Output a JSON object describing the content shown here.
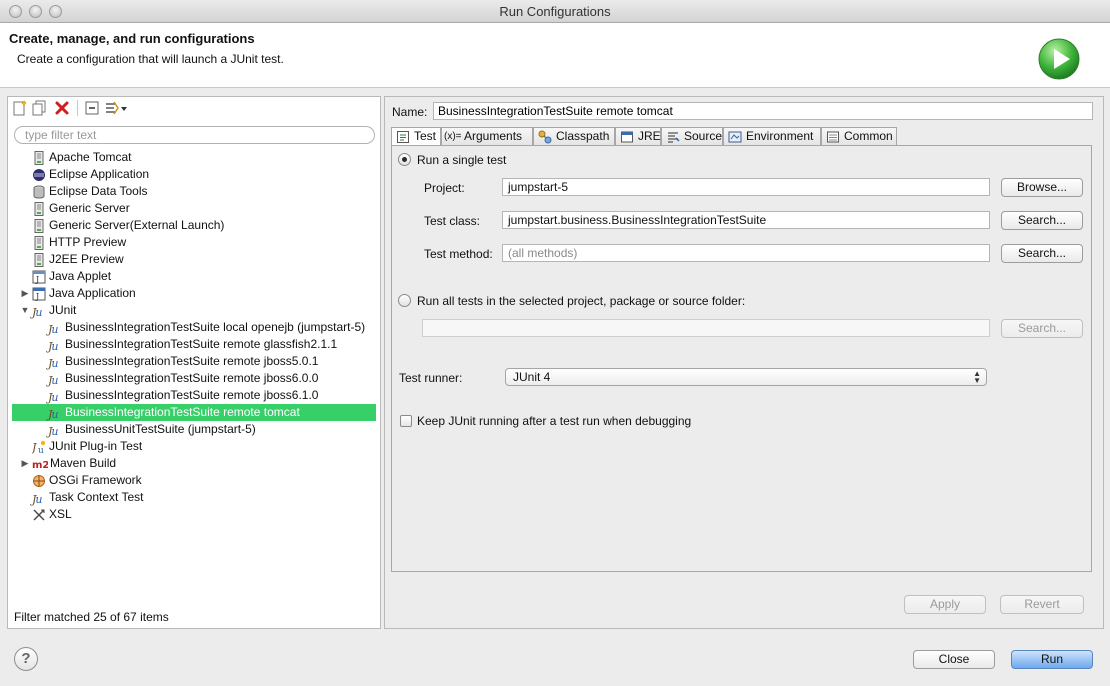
{
  "window": {
    "title": "Run Configurations"
  },
  "banner": {
    "heading": "Create, manage, and run configurations",
    "message": "Create a configuration that will launch a JUnit test."
  },
  "left": {
    "filter_placeholder": "type filter text",
    "tree": [
      {
        "label": "Apache Tomcat",
        "icon": "server-icon",
        "level": 0
      },
      {
        "label": "Eclipse Application",
        "icon": "eclipse-icon",
        "level": 0
      },
      {
        "label": "Eclipse Data Tools",
        "icon": "database-icon",
        "level": 0
      },
      {
        "label": "Generic Server",
        "icon": "server-icon",
        "level": 0
      },
      {
        "label": "Generic Server(External Launch)",
        "icon": "server-icon",
        "level": 0
      },
      {
        "label": "HTTP Preview",
        "icon": "server-icon",
        "level": 0
      },
      {
        "label": "J2EE Preview",
        "icon": "server-icon",
        "level": 0
      },
      {
        "label": "Java Applet",
        "icon": "applet-icon",
        "level": 0
      },
      {
        "label": "Java Application",
        "icon": "java-app-icon",
        "level": 0,
        "arrow": "collapsed"
      },
      {
        "label": "JUnit",
        "icon": "junit-icon",
        "level": 0,
        "arrow": "expanded"
      },
      {
        "label": "BusinessIntegrationTestSuite local openejb (jumpstart-5)",
        "icon": "junit-icon",
        "level": 1
      },
      {
        "label": "BusinessIntegrationTestSuite remote glassfish2.1.1",
        "icon": "junit-icon",
        "level": 1
      },
      {
        "label": "BusinessIntegrationTestSuite remote jboss5.0.1",
        "icon": "junit-icon",
        "level": 1
      },
      {
        "label": "BusinessIntegrationTestSuite remote jboss6.0.0",
        "icon": "junit-icon",
        "level": 1
      },
      {
        "label": "BusinessIntegrationTestSuite remote jboss6.1.0",
        "icon": "junit-icon",
        "level": 1
      },
      {
        "label": "BusinessIntegrationTestSuite remote tomcat",
        "icon": "junit-icon",
        "level": 1,
        "selected": true
      },
      {
        "label": "BusinessUnitTestSuite (jumpstart-5)",
        "icon": "junit-icon",
        "level": 1
      },
      {
        "label": "JUnit Plug-in Test",
        "icon": "junit-plugin-icon",
        "level": 0
      },
      {
        "label": "Maven Build",
        "icon": "maven-icon",
        "level": 0,
        "arrow": "collapsed"
      },
      {
        "label": "OSGi Framework",
        "icon": "osgi-icon",
        "level": 0
      },
      {
        "label": "Task Context Test",
        "icon": "junit-icon",
        "level": 0
      },
      {
        "label": "XSL",
        "icon": "xsl-icon",
        "level": 0
      }
    ],
    "status": "Filter matched 25 of 67 items"
  },
  "right": {
    "name_label": "Name:",
    "name_value": "BusinessIntegrationTestSuite remote tomcat",
    "tabs": [
      {
        "label": "Test",
        "icon": "test-tab-icon",
        "active": true
      },
      {
        "label": "Arguments",
        "icon": "arguments-icon",
        "prefix": "(x)="
      },
      {
        "label": "Classpath",
        "icon": "classpath-icon"
      },
      {
        "label": "JRE",
        "icon": "jre-icon"
      },
      {
        "label": "Source",
        "icon": "source-icon"
      },
      {
        "label": "Environment",
        "icon": "environment-icon"
      },
      {
        "label": "Common",
        "icon": "common-icon"
      }
    ],
    "test": {
      "single_label": "Run a single test",
      "project_label": "Project:",
      "project_value": "jumpstart-5",
      "browse_label": "Browse...",
      "class_label": "Test class:",
      "class_value": "jumpstart.business.BusinessIntegrationTestSuite",
      "class_search_label": "Search...",
      "method_label": "Test method:",
      "method_placeholder": "(all methods)",
      "method_search_label": "Search...",
      "all_label": "Run all tests in the selected project, package or source folder:",
      "all_search_label": "Search...",
      "runner_label": "Test runner:",
      "runner_value": "JUnit 4",
      "keep_label": "Keep JUnit running after a test run when debugging"
    },
    "apply_label": "Apply",
    "revert_label": "Revert"
  },
  "footer": {
    "help_label": "?",
    "close_label": "Close",
    "run_label": "Run"
  }
}
